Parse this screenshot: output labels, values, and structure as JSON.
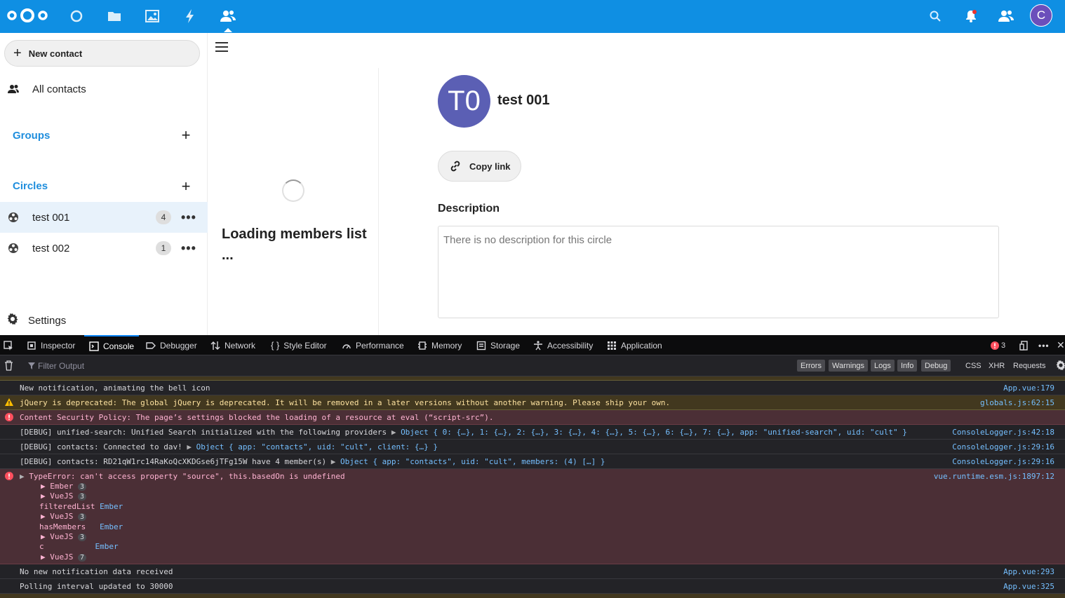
{
  "colors": {
    "topbar": "#0f8fe3",
    "accent": "#1f8edd",
    "circle_avatar": "#5b5fb4",
    "user_avatar": "#6b4fbb"
  },
  "header": {
    "apps": [
      "dashboard-icon",
      "files-icon",
      "photos-icon",
      "activity-icon",
      "contacts-icon"
    ],
    "user_initial": "C"
  },
  "sidebar": {
    "new_contact": "New contact",
    "all_contacts": "All contacts",
    "groups_caption": "Groups",
    "circles_caption": "Circles",
    "circles": [
      {
        "label": "test 001",
        "count": "4"
      },
      {
        "label": "test 002",
        "count": "1"
      }
    ],
    "settings": "Settings"
  },
  "main": {
    "loading_text": "Loading members list ...",
    "circle_initials": "T0",
    "circle_title": "test 001",
    "copy_link": "Copy link",
    "description_label": "Description",
    "description_placeholder": "There is no description for this circle"
  },
  "devtools": {
    "tabs": [
      "Inspector",
      "Console",
      "Debugger",
      "Network",
      "Style Editor",
      "Performance",
      "Memory",
      "Storage",
      "Accessibility",
      "Application"
    ],
    "active_tab": "Console",
    "error_count": "3",
    "filter_placeholder": "Filter Output",
    "filters": [
      "Errors",
      "Warnings",
      "Logs",
      "Info",
      "Debug",
      "CSS",
      "XHR",
      "Requests"
    ],
    "logs": [
      {
        "level": "log",
        "msg": "New notification, animating the bell icon",
        "src": "App.vue:179"
      },
      {
        "level": "warn",
        "msg": "jQuery is deprecated: The global jQuery is deprecated. It will be removed in a later versions without another warning. Please ship your own.",
        "src": "globals.js:62:15"
      },
      {
        "level": "error",
        "msg": "Content Security Policy: The page’s settings blocked the loading of a resource at eval (“script-src”).",
        "src": ""
      },
      {
        "level": "debug",
        "msg_prefix": "[DEBUG] unified-search: Unified Search initialized with the following providers ",
        "obj": "Object { 0: {…}, 1: {…}, 2: {…}, 3: {…}, 4: {…}, 5: {…}, 6: {…}, 7: {…}, app: \"unified-search\", uid: \"cult\" }",
        "src": "ConsoleLogger.js:42:18"
      },
      {
        "level": "debug",
        "msg_prefix": "[DEBUG] contacts: Connected to dav! ",
        "obj": "Object { app: \"contacts\", uid: \"cult\", client: {…} }",
        "src": "ConsoleLogger.js:29:16"
      },
      {
        "level": "debug",
        "msg_prefix": "[DEBUG] contacts: RD21qW1rc14RaKoQcXKDGse6jTFg15W have 4 member(s) ",
        "obj": "Object { app: \"contacts\", uid: \"cult\", members: (4) […] }",
        "src": "ConsoleLogger.js:29:16"
      },
      {
        "level": "error",
        "msg": "TypeError: can't access property \"source\", this.basedOn is undefined",
        "src": "vue.runtime.esm.js:1897:12"
      },
      {
        "level": "log",
        "msg": "No new notification data received",
        "src": "App.vue:293"
      },
      {
        "level": "log",
        "msg": "Polling interval updated to 30000",
        "src": "App.vue:325"
      }
    ],
    "stack": {
      "ember": "Ember",
      "vuejs": "VueJS",
      "filtered_list": "filteredList",
      "has_members": "hasMembers",
      "c": "c",
      "counts": [
        "3",
        "3",
        "3",
        "3",
        "7"
      ]
    }
  }
}
